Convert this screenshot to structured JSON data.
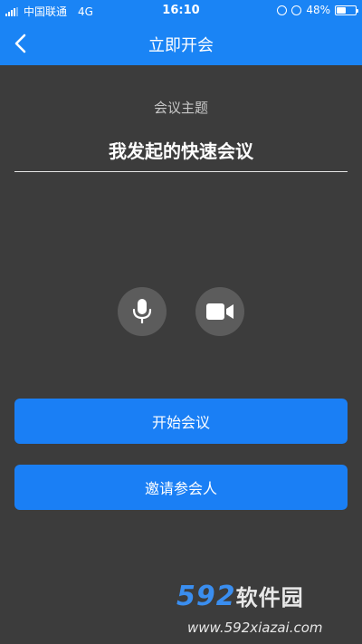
{
  "status_bar": {
    "carrier": "中国联通",
    "network": "4G",
    "time": "16:10",
    "battery_percent": "48%",
    "battery_level": 0.48
  },
  "nav": {
    "back_icon": "chevron-left-icon",
    "title": "立即开会"
  },
  "meeting": {
    "topic_label": "会议主题",
    "topic_value": "我发起的快速会议"
  },
  "controls": {
    "mic_icon": "microphone-icon",
    "camera_icon": "video-camera-icon"
  },
  "actions": {
    "start_label": "开始会议",
    "invite_label": "邀请参会人"
  },
  "watermark": {
    "logo_number": "592",
    "logo_text": "软件园",
    "url": "www.592xiazai.com"
  },
  "colors": {
    "brand_blue": "#1a84f5",
    "button_blue": "#1a7ff5",
    "background": "#3c3c3c",
    "icon_circle": "#5c5c5c"
  }
}
